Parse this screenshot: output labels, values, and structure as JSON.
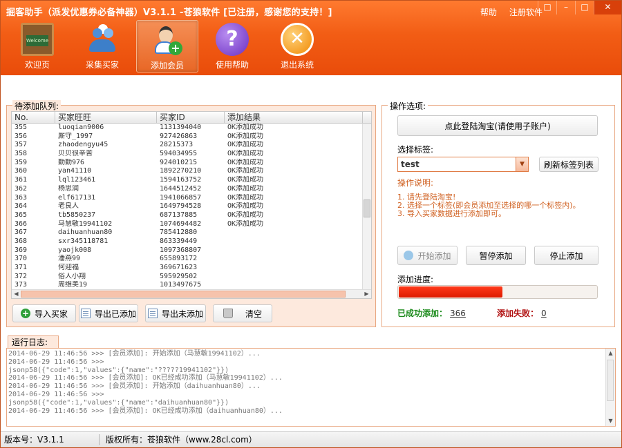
{
  "window": {
    "title": "掘客助手（派发优惠券必备神器）V3.1.1 -苍狼软件 [已注册，感谢您的支持！]",
    "links": [
      "帮助",
      "注册软件"
    ],
    "controls": [
      "□",
      "–",
      "□",
      "✕"
    ]
  },
  "toolbar": [
    {
      "label": "欢迎页",
      "icon": "welcome-board-icon"
    },
    {
      "label": "采集买家",
      "icon": "collect-buyers-icon"
    },
    {
      "label": "添加会员",
      "icon": "add-member-icon"
    },
    {
      "label": "使用帮助",
      "icon": "help-icon"
    },
    {
      "label": "退出系统",
      "icon": "exit-icon"
    }
  ],
  "queue": {
    "title": "待添加队列:",
    "columns": [
      "No.",
      "买家旺旺",
      "买家ID",
      "添加结果"
    ],
    "rows": [
      [
        "355",
        "luoqian9006",
        "1131394040",
        "OK添加成功"
      ],
      [
        "356",
        "厮守_1997",
        "927426863",
        "OK添加成功"
      ],
      [
        "357",
        "zhaodengyu45",
        "28215373",
        "OK添加成功"
      ],
      [
        "358",
        "贝贝很辛苦",
        "594034955",
        "OK添加成功"
      ],
      [
        "359",
        "勤勤976",
        "924010215",
        "OK添加成功"
      ],
      [
        "360",
        "yan41110",
        "1892270210",
        "OK添加成功"
      ],
      [
        "361",
        "lql123461",
        "1594163752",
        "OK添加成功"
      ],
      [
        "362",
        "杨思润",
        "1644512452",
        "OK添加成功"
      ],
      [
        "363",
        "elf617131",
        "1941066857",
        "OK添加成功"
      ],
      [
        "364",
        "老良人",
        "1649794528",
        "OK添加成功"
      ],
      [
        "365",
        "tb5850237",
        "687137885",
        "OK添加成功"
      ],
      [
        "366",
        "马慧敏19941102",
        "1074694482",
        "OK添加成功"
      ],
      [
        "367",
        "daihuanhuan80",
        "785412880",
        ""
      ],
      [
        "368",
        "sxr345118781",
        "863339449",
        ""
      ],
      [
        "369",
        "yaojk008",
        "1097368807",
        ""
      ],
      [
        "370",
        "潘燕99",
        "655893172",
        ""
      ],
      [
        "371",
        "何迎福",
        "369671623",
        ""
      ],
      [
        "372",
        "俗人小翔",
        "595929502",
        ""
      ],
      [
        "373",
        "周维美19",
        "1013497675",
        ""
      ]
    ],
    "buttons": {
      "import": "导入买家",
      "export_added": "导出已添加",
      "export_pending": "导出未添加",
      "clear": "清空"
    }
  },
  "options": {
    "title": "操作选项:",
    "login_button": "点此登陆淘宝(请使用子账户)",
    "tag_label": "选择标签:",
    "tag_value": "test",
    "refresh_button": "刷新标签列表",
    "instructions_title": "操作说明:",
    "instructions": [
      "1. 请先登陆淘宝!",
      "2. 选择一个标签(即会员添加至选择的哪一个标签内)。",
      "3. 导入买家数据进行添加即可。"
    ],
    "start_button": "开始添加",
    "pause_button": "暂停添加",
    "stop_button": "停止添加",
    "progress_label": "添加进度:",
    "progress_fraction": 0.52,
    "success_label": "已成功添加：",
    "success_count": "366",
    "fail_label": "添加失败：",
    "fail_count": "0"
  },
  "log": {
    "title": "运行日志:",
    "lines": [
      "2014-06-29 11:46:56 >>> [会员添加]: 开始添加（马慧敏19941102）...",
      "2014-06-29 11:46:56 >>>",
      "jsonp58({\"code\":1,\"values\":{\"name\":\"?????19941102\"}})",
      "2014-06-29 11:46:56 >>> [会员添加]: OK已经成功添加（马慧敏19941102）...",
      "2014-06-29 11:46:56 >>> [会员添加]: 开始添加（daihuanhuan80）...",
      "2014-06-29 11:46:56 >>>",
      "jsonp58({\"code\":1,\"values\":{\"name\":\"daihuanhuan80\"}})",
      "2014-06-29 11:46:56 >>> [会员添加]: OK已经成功添加（daihuanhuan80）..."
    ]
  },
  "statusbar": {
    "version": "版本号：V3.1.1",
    "copyright": "版权所有：苍狼软件（www.28cl.com）"
  },
  "colors": {
    "accent": "#f25d15",
    "success": "#1a8a1a",
    "fail": "#b01010",
    "progress": "#e52a08"
  }
}
